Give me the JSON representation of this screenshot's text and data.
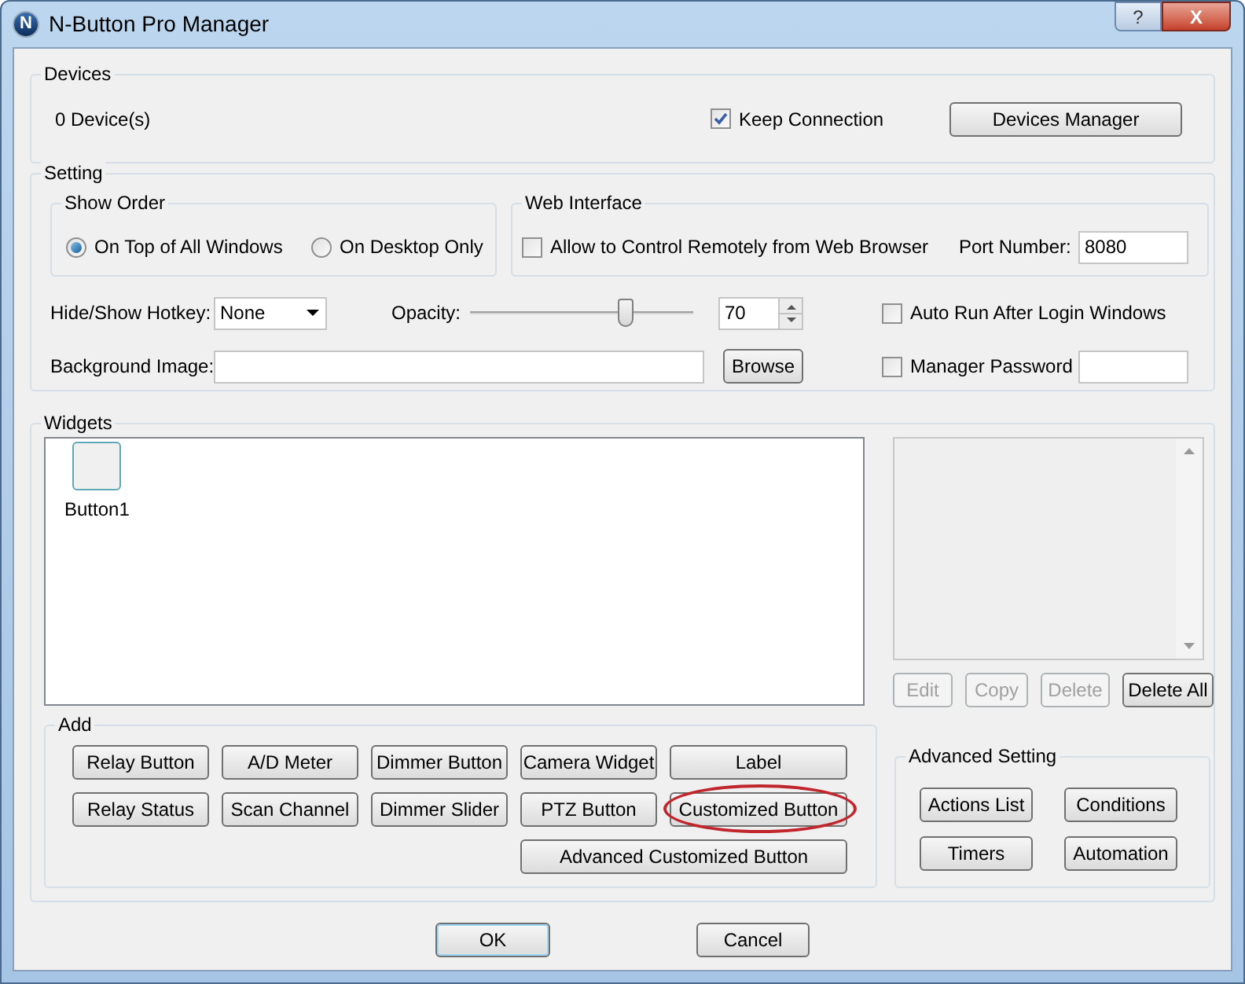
{
  "window": {
    "logo_letter": "N",
    "title": "N-Button Pro Manager",
    "help": "?",
    "close": "X"
  },
  "devices": {
    "legend": "Devices",
    "count": "0 Device(s)",
    "keep_connection": {
      "label": "Keep Connection",
      "checked": true
    },
    "manager_button": "Devices Manager"
  },
  "setting": {
    "legend": "Setting",
    "show_order": {
      "legend": "Show Order",
      "options": [
        {
          "label": "On Top of All Windows",
          "selected": true
        },
        {
          "label": "On Desktop Only",
          "selected": false
        }
      ]
    },
    "web_interface": {
      "legend": "Web Interface",
      "allow_remote": {
        "label": "Allow to Control Remotely from Web Browser",
        "checked": false
      },
      "port_label": "Port Number:",
      "port_value": "8080"
    },
    "hotkey": {
      "label": "Hide/Show Hotkey:",
      "value": "None"
    },
    "opacity": {
      "label": "Opacity:",
      "level": 0.7,
      "value": "70"
    },
    "auto_run": {
      "label": "Auto Run After Login Windows",
      "checked": false
    },
    "background_image": {
      "label": "Background Image:",
      "browse_button": "Browse"
    },
    "manager_password": {
      "label": "Manager Password",
      "checked": false
    }
  },
  "widgets": {
    "legend": "Widgets",
    "items": [
      {
        "label": "Button1"
      }
    ],
    "actions": [
      {
        "label": "Edit",
        "disabled": true
      },
      {
        "label": "Copy",
        "disabled": true
      },
      {
        "label": "Delete",
        "disabled": true
      },
      {
        "label": "Delete All",
        "disabled": false
      }
    ],
    "add": {
      "legend": "Add",
      "buttons": [
        {
          "label": "Relay Button",
          "circled": false
        },
        {
          "label": "A/D Meter",
          "circled": false
        },
        {
          "label": "Dimmer Button",
          "circled": false
        },
        {
          "label": "Camera Widget",
          "circled": false
        },
        {
          "label": "Label",
          "circled": false
        },
        {
          "label": "Relay Status",
          "circled": false
        },
        {
          "label": "Scan Channel",
          "circled": false
        },
        {
          "label": "Dimmer Slider",
          "circled": false
        },
        {
          "label": "PTZ Button",
          "circled": false
        },
        {
          "label": "Customized Button",
          "circled": true
        }
      ],
      "wide_button": {
        "label": "Advanced Customized Button",
        "circled": false
      }
    },
    "advanced": {
      "legend": "Advanced Setting",
      "buttons": [
        "Actions List",
        "Conditions",
        "Timers",
        "Automation"
      ]
    }
  },
  "footer": {
    "buttons": [
      {
        "label": "OK",
        "default": true
      },
      {
        "label": "Cancel",
        "default": false
      }
    ]
  }
}
